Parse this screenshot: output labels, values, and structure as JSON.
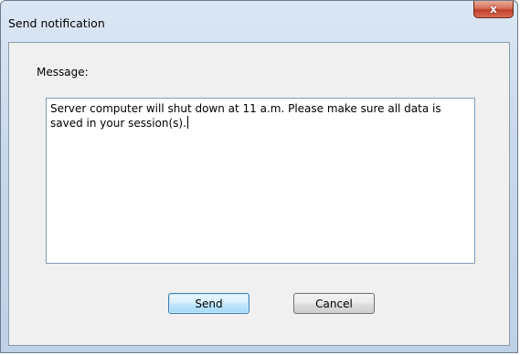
{
  "window": {
    "title": "Send notification",
    "close_glyph": "x"
  },
  "form": {
    "message_label": "Message:",
    "message_value": "Server computer will shut down at 11 a.m. Please make sure all data is saved in your session(s)."
  },
  "buttons": {
    "send_label": "Send",
    "cancel_label": "Cancel"
  },
  "colors": {
    "frame": "#c9d9ec",
    "client": "#f0f0f0",
    "close": "#c0402a",
    "default_button_border": "#3c7fb1"
  },
  "icons": [
    "close-icon"
  ]
}
